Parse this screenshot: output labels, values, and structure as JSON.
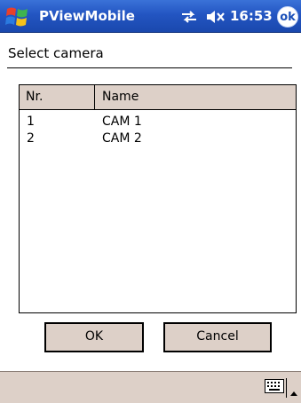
{
  "titlebar": {
    "app_title": "PViewMobile",
    "clock": "16:53",
    "ok_label": "ok",
    "start_icon": "windows-flag-icon",
    "connectivity_icon": "connectivity-icon",
    "volume_icon": "volume-muted-icon"
  },
  "main": {
    "heading": "Select camera",
    "list": {
      "columns": [
        "Nr.",
        "Name"
      ],
      "rows": [
        {
          "nr": "1",
          "name": "CAM 1"
        },
        {
          "nr": "2",
          "name": "CAM 2"
        }
      ]
    },
    "buttons": {
      "ok": "OK",
      "cancel": "Cancel"
    }
  },
  "bottombar": {
    "keyboard_icon": "keyboard-icon",
    "sip_arrow_icon": "up-arrow-icon"
  },
  "colors": {
    "title_bar": "#2355c2",
    "panel_beige": "#ddd0c8"
  }
}
